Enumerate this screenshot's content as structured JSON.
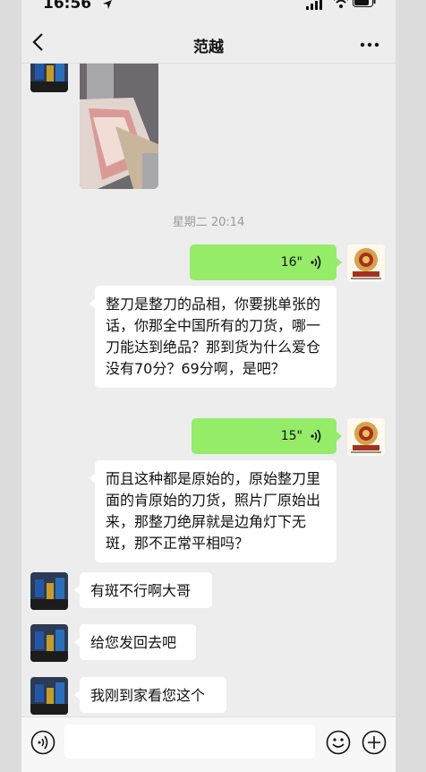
{
  "status": {
    "time": "16:56"
  },
  "header": {
    "title": "范越"
  },
  "chat": {
    "timestamp": "星期二 20:14",
    "messages": [
      {
        "side": "right",
        "type": "voice",
        "duration": "16\""
      },
      {
        "side": "left",
        "type": "text",
        "text": "整刀是整刀的品相，你要挑单张的话，你那全中国所有的刀货，哪一刀能达到绝品？那到货为什么爱仓没有70分？69分啊，是吧？"
      },
      {
        "side": "right",
        "type": "voice",
        "duration": "15\""
      },
      {
        "side": "left",
        "type": "text",
        "text": "而且这种都是原始的，原始整刀里面的肯原始的刀货，照片厂原始出来，那整刀绝屏就是边角灯下无斑，那不正常平相吗？"
      },
      {
        "side": "left",
        "type": "text",
        "text": "有斑不行啊大哥"
      },
      {
        "side": "left",
        "type": "text",
        "text": "给您发回去吧"
      },
      {
        "side": "left",
        "type": "text",
        "text": "我刚到家看您这个"
      }
    ]
  },
  "colors": {
    "sent_bubble": "#95ec69",
    "received_bubble": "#ffffff",
    "background": "#ededed"
  }
}
